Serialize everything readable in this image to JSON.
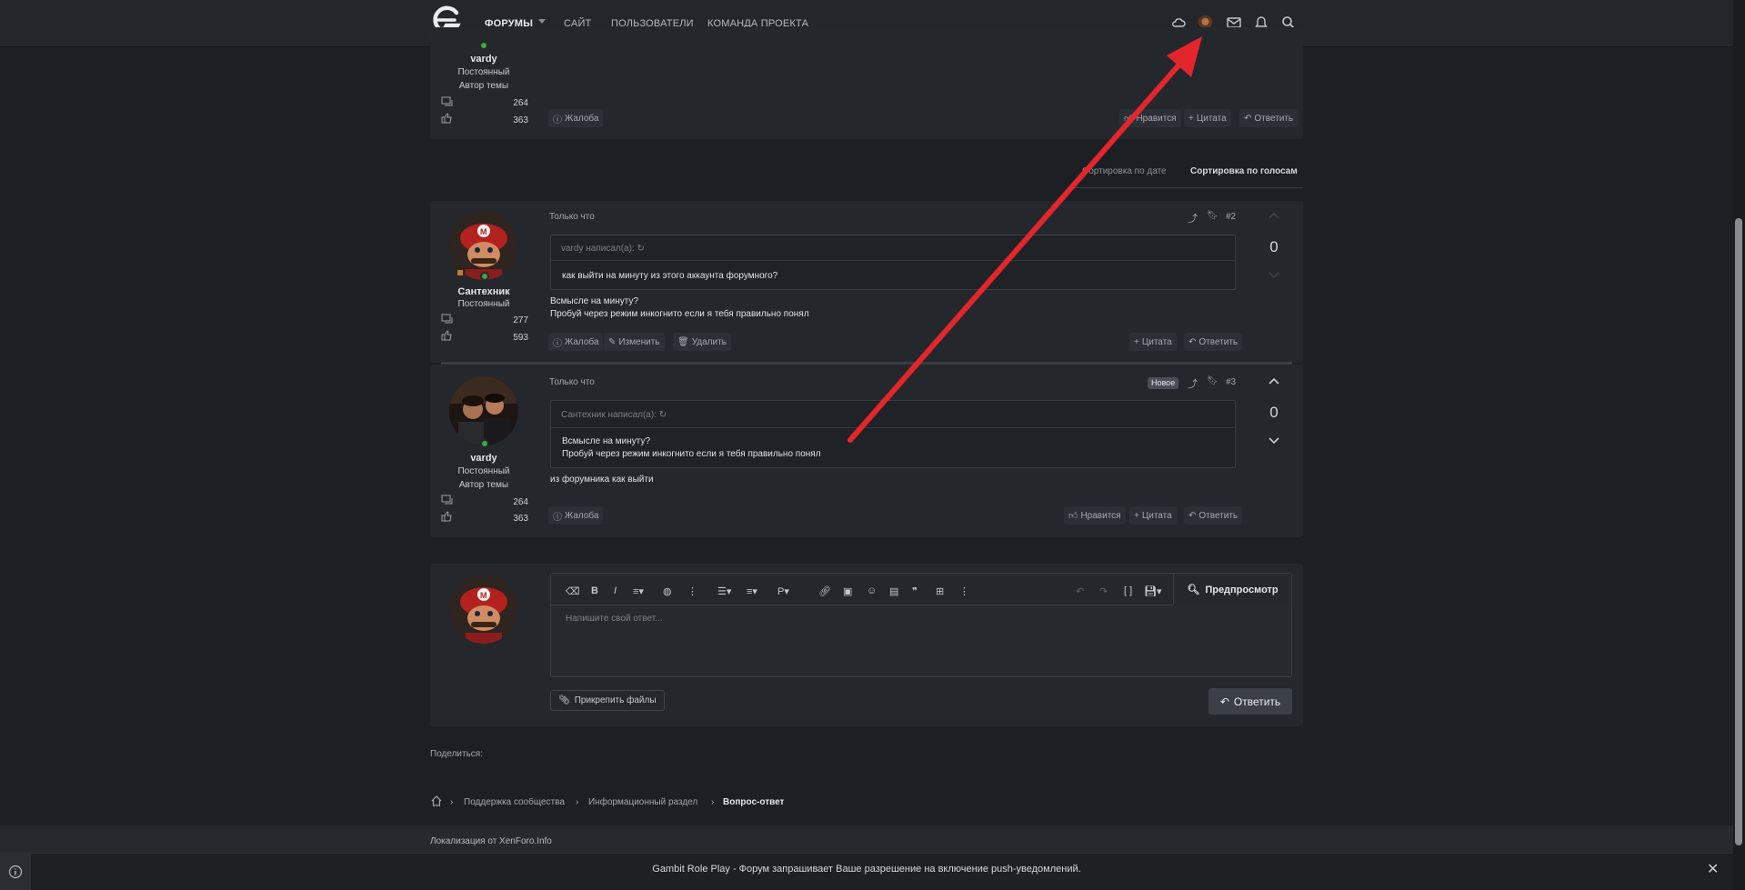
{
  "nav": {
    "links": [
      "Форумы",
      "Сайт",
      "Пользователи",
      "Команда проекта"
    ]
  },
  "posts": [
    {
      "username": "vardy",
      "titles": [
        "Постоянный",
        "Автор темы"
      ],
      "messages": "264",
      "likes": "363",
      "buttons": {
        "report": "Жалоба",
        "like": "Нравится",
        "quote": "Цитата",
        "reply": "Ответить"
      }
    },
    {
      "username": "Сантехник",
      "titles": [
        "Постоянный"
      ],
      "messages": "277",
      "likes": "593",
      "time": "Только что",
      "number": "#2",
      "votes": "0",
      "quote_author": "vardy написал(а):",
      "quote_text": "как выйти на минуту из этого аккаунта форумного?",
      "text": [
        "Всмысле на минуту?",
        "Пробуй через режим инкогнито если я тебя правильно понял"
      ],
      "buttons": {
        "report": "Жалоба",
        "edit": "Изменить",
        "delete": "Удалить",
        "quote": "Цитата",
        "reply": "Ответить"
      }
    },
    {
      "username": "vardy",
      "titles": [
        "Постоянный",
        "Автор темы"
      ],
      "messages": "264",
      "likes": "363",
      "time": "Только что",
      "badge": "Новое",
      "number": "#3",
      "votes": "0",
      "quote_author": "Сантехник написал(а):",
      "quote_text": [
        "Всмысле на минуту?",
        "Пробуй через режим инкогнито если я тебя правильно понял"
      ],
      "text": "из форумника как выйти",
      "buttons": {
        "report": "Жалоба",
        "like": "Нравится",
        "quote": "Цитата",
        "reply": "Ответить"
      }
    }
  ],
  "sort": {
    "by_date": "Сортировка по дате",
    "by_votes": "Сортировка по голосам"
  },
  "editor": {
    "placeholder": "Напишите свой ответ...",
    "preview": "Предпросмотр",
    "attach": "Прикрепить файлы",
    "submit": "Ответить"
  },
  "share_label": "Поделиться:",
  "breadcrumbs": [
    "Поддержка сообщества",
    "Информационный раздел",
    "Вопрос-ответ"
  ],
  "footer": {
    "localization": "Локализация от XenForo.Info"
  },
  "push": {
    "message": "Gambit Role Play - Форум запрашивает Ваше разрешение на включение push-уведомлений."
  },
  "colors": {
    "annotation_arrow": "#e3262b",
    "online": "#3ea93e"
  }
}
